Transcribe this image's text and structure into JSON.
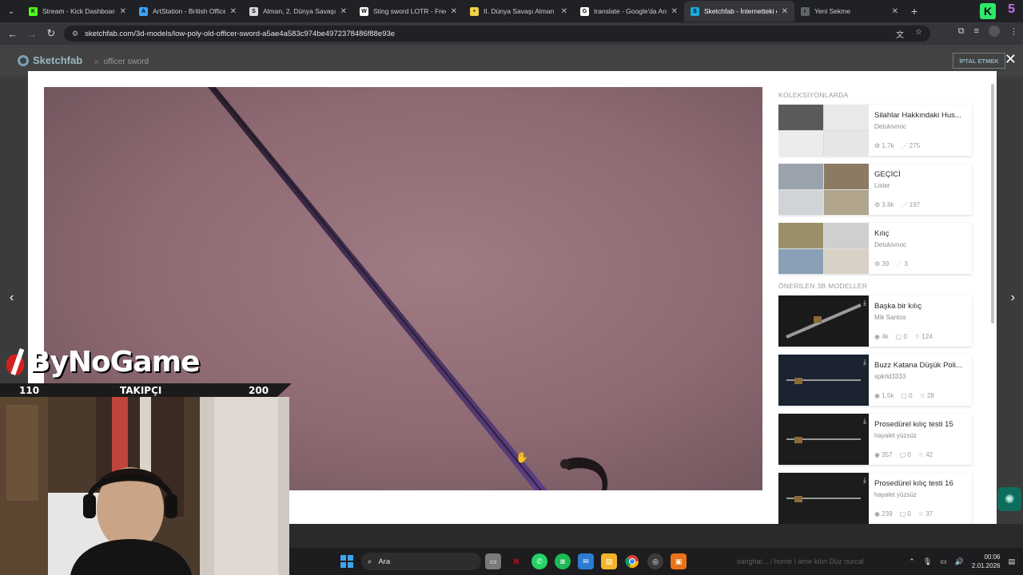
{
  "browser": {
    "tabs": [
      {
        "title": "Stream - Kick Dashboard",
        "fav_color": "#53fc18",
        "fav_glyph": "K"
      },
      {
        "title": "ArtStation - British Officer",
        "fav_color": "#3aa3ff",
        "fav_glyph": "A"
      },
      {
        "title": "Alman, 2. Dünya Savaşı, S",
        "fav_color": "#d9d9d9",
        "fav_glyph": "S"
      },
      {
        "title": "Sting sword LOTR - Free 3",
        "fav_color": "#ffffff",
        "fav_glyph": "W"
      },
      {
        "title": "II. Dünya Savaşı Alman SS",
        "fav_color": "#f2d14a",
        "fav_glyph": "•"
      },
      {
        "title": "translate - Google'da Ara",
        "fav_color": "#ffffff",
        "fav_glyph": "G"
      },
      {
        "title": "Sketchfab - İnternetteki e",
        "fav_color": "#1caad9",
        "fav_glyph": "S",
        "active": true
      },
      {
        "title": "Yeni Sekme",
        "fav_color": "#5f6368",
        "fav_glyph": "◐"
      }
    ],
    "url": "sketchfab.com/3d-models/low-poly-old-officer-sword-a5ae4a583c974be4972378486f88e93e"
  },
  "sketchfab": {
    "logo": "Sketchfab",
    "search_value": "officer sword",
    "cancel_label": "İPTAL ETMEK"
  },
  "sidebar": {
    "collections_title": "KOLEKSİYONLARDA",
    "collections": [
      {
        "title": "Silahlar Hakkındaki Hus...",
        "owner": "Detulovnoc",
        "stat1": "1.7k",
        "stat2": "275",
        "thumbs": [
          "#5a5a5a",
          "#e9e9e9",
          "#ececec",
          "#e6e6e6"
        ]
      },
      {
        "title": "GEÇİCİ",
        "owner": "Lister",
        "stat1": "3.8k",
        "stat2": "197",
        "thumbs": [
          "#9aa3ad",
          "#8c7a63",
          "#d0d4d8",
          "#b0a48c"
        ]
      },
      {
        "title": "Kılıç",
        "owner": "Detulovnoc",
        "stat1": "39",
        "stat2": "3",
        "thumbs": [
          "#9b8f6a",
          "#cfcfcf",
          "#8aa0b6",
          "#d8d2c6"
        ]
      }
    ],
    "recommended_title": "ÖNERİLEN 3B MODELLER",
    "recommended": [
      {
        "title": "Başka bir kılıç",
        "owner": "Mik Santos",
        "views": "4k",
        "comments": "0",
        "likes": "124",
        "bg": "#1a1a1a"
      },
      {
        "title": "Buzz Katana Düşük Poli...",
        "owner": "spkrld3333",
        "views": "1.5k",
        "comments": "0",
        "likes": "28",
        "bg": "#1b2230"
      },
      {
        "title": "Prosedürel kılıç testi 15",
        "owner": "hayalet yüzsüz",
        "views": "357",
        "comments": "0",
        "likes": "42",
        "bg": "#1c1c1c"
      },
      {
        "title": "Prosedürel kılıç testi 16",
        "owner": "hayalet yüzsüz",
        "views": "239",
        "comments": "0",
        "likes": "37",
        "bg": "#1c1c1c"
      }
    ]
  },
  "overlay": {
    "brand": "ByNoGame",
    "followers_current": "110",
    "followers_label": "TAKIPÇI",
    "followers_goal": "200"
  },
  "taskbar": {
    "search_label": "Ara",
    "time": "00:06",
    "date": "2.01.2026",
    "ghost_text": "sanghai... / home \\ ame kılın Düz nurcal"
  }
}
